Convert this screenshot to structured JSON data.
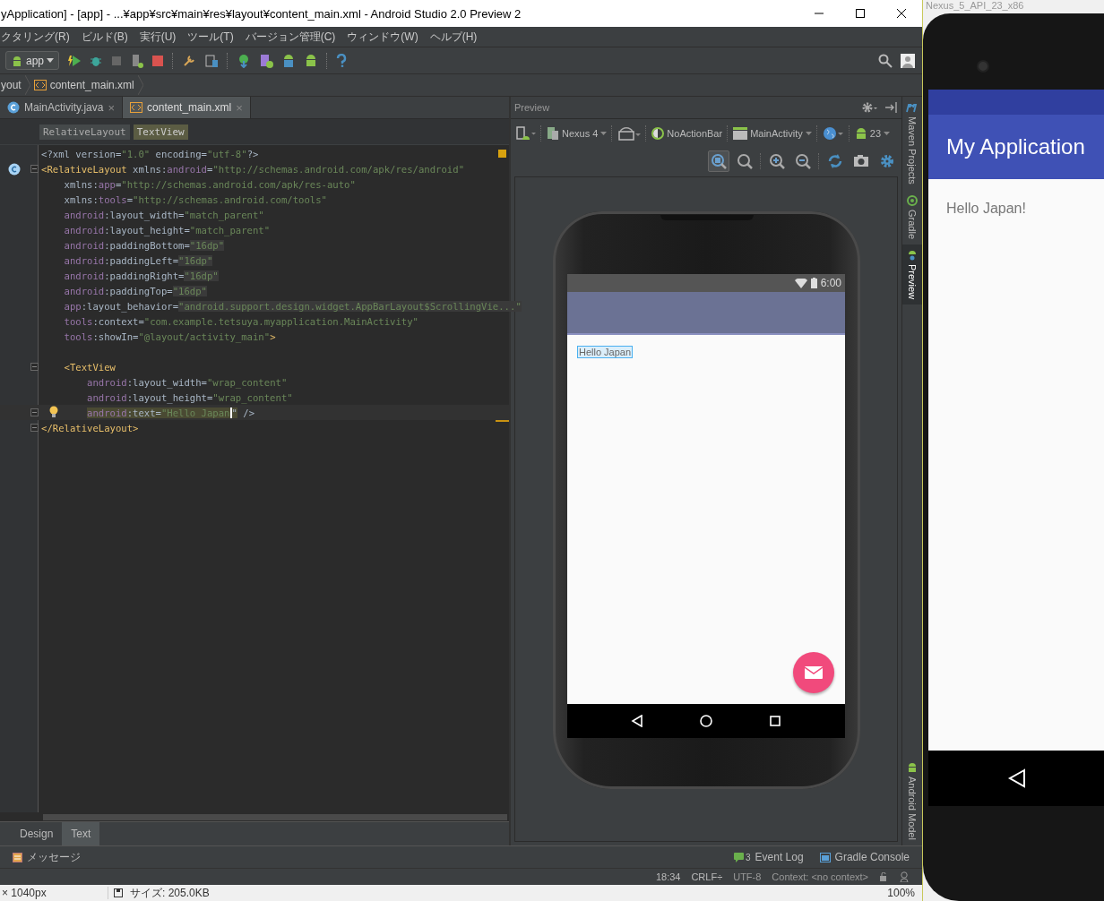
{
  "window": {
    "title": "yApplication] - [app] - ...¥app¥src¥main¥res¥layout¥content_main.xml - Android Studio 2.0 Preview 2"
  },
  "menu": [
    "クタリング(R)",
    "ビルド(B)",
    "実行(U)",
    "ツール(T)",
    "バージョン管理(C)",
    "ウィンドウ(W)",
    "ヘルプ(H)"
  ],
  "toolbar": {
    "run_config": "app"
  },
  "breadcrumb": [
    {
      "label": "yout",
      "kind": "folder"
    },
    {
      "label": "content_main.xml",
      "kind": "xml"
    }
  ],
  "editor_tabs": [
    {
      "label": "MainActivity.java",
      "kind": "java",
      "selected": false,
      "close": "×"
    },
    {
      "label": "content_main.xml",
      "kind": "xml",
      "selected": true,
      "close": "×"
    }
  ],
  "tag_path": [
    {
      "label": "RelativeLayout",
      "selected": false
    },
    {
      "label": "TextView",
      "selected": true
    }
  ],
  "code_lines": [
    {
      "current": false,
      "fold": false,
      "tokens": [
        {
          "kind": "p",
          "text": "<?xml version="
        },
        {
          "kind": "val",
          "text": "\"1.0\""
        },
        {
          "kind": "p",
          "text": " encoding="
        },
        {
          "kind": "val",
          "text": "\"utf-8\""
        },
        {
          "kind": "p",
          "text": "?>"
        }
      ]
    },
    {
      "kind": "class-marker",
      "current": false,
      "fold": true,
      "tokens": [
        {
          "kind": "tag",
          "text": "<RelativeLayout"
        },
        {
          "kind": "p",
          "text": " xmlns:"
        },
        {
          "kind": "ns",
          "text": "android"
        },
        {
          "kind": "p",
          "text": "="
        },
        {
          "kind": "val",
          "text": "\"http://schemas.android.com/apk/res/android\""
        }
      ],
      "children": [
        {
          "current": false,
          "fold": false,
          "tokens": [
            {
              "kind": "p",
              "text": "xmlns:"
            },
            {
              "kind": "ns",
              "text": "app"
            },
            {
              "kind": "p",
              "text": "="
            },
            {
              "kind": "val",
              "text": "\"http://schemas.android.com/apk/res-auto\""
            }
          ]
        },
        {
          "current": false,
          "fold": false,
          "tokens": [
            {
              "kind": "p",
              "text": "xmlns:"
            },
            {
              "kind": "ns",
              "text": "tools"
            },
            {
              "kind": "p",
              "text": "="
            },
            {
              "kind": "val",
              "text": "\"http://schemas.android.com/tools\""
            }
          ]
        },
        {
          "current": false,
          "fold": false,
          "tokens": [
            {
              "kind": "ns",
              "text": "android"
            },
            {
              "kind": "p",
              "text": ":layout_width="
            },
            {
              "kind": "val",
              "text": "\"match_parent\""
            }
          ]
        },
        {
          "current": false,
          "fold": false,
          "tokens": [
            {
              "kind": "ns",
              "text": "android"
            },
            {
              "kind": "p",
              "text": ":layout_height="
            },
            {
              "kind": "val",
              "text": "\"match_parent\""
            }
          ]
        },
        {
          "current": false,
          "fold": false,
          "tokens": [
            {
              "kind": "ns",
              "text": "android"
            },
            {
              "kind": "p",
              "text": ":paddingBottom="
            },
            {
              "kind": "fold",
              "text": "\"16dp\""
            }
          ]
        },
        {
          "current": false,
          "fold": false,
          "tokens": [
            {
              "kind": "ns",
              "text": "android"
            },
            {
              "kind": "p",
              "text": ":paddingLeft="
            },
            {
              "kind": "fold",
              "text": "\"16dp\""
            }
          ]
        },
        {
          "current": false,
          "fold": false,
          "tokens": [
            {
              "kind": "ns",
              "text": "android"
            },
            {
              "kind": "p",
              "text": ":paddingRight="
            },
            {
              "kind": "fold",
              "text": "\"16dp\""
            }
          ]
        },
        {
          "current": false,
          "fold": false,
          "tokens": [
            {
              "kind": "ns",
              "text": "android"
            },
            {
              "kind": "p",
              "text": ":paddingTop="
            },
            {
              "kind": "fold",
              "text": "\"16dp\""
            }
          ]
        },
        {
          "current": false,
          "fold": false,
          "tokens": [
            {
              "kind": "ns",
              "text": "app"
            },
            {
              "kind": "p",
              "text": ":layout_behavior="
            },
            {
              "kind": "fold",
              "text": "\"android.support.design.widget.AppBarLayout$ScrollingVie...\""
            }
          ]
        },
        {
          "current": false,
          "fold": false,
          "tokens": [
            {
              "kind": "ns",
              "text": "tools"
            },
            {
              "kind": "p",
              "text": ":context="
            },
            {
              "kind": "val",
              "text": "\"com.example.tetsuya.myapplication.MainActivity\""
            }
          ]
        },
        {
          "current": false,
          "fold": false,
          "tokens": [
            {
              "kind": "ns",
              "text": "tools"
            },
            {
              "kind": "p",
              "text": ":showIn="
            },
            {
              "kind": "val",
              "text": "\"@layout/activity_main\""
            },
            {
              "kind": "tag",
              "text": ">"
            }
          ]
        },
        {
          "current": false,
          "fold": false
        },
        {
          "current": false,
          "fold": true,
          "tokens": [
            {
              "kind": "tag",
              "text": "<TextView"
            }
          ],
          "children": [
            {
              "current": false,
              "fold": false,
              "tokens": [
                {
                  "kind": "ns",
                  "text": "android"
                },
                {
                  "kind": "p",
                  "text": ":layout_width="
                },
                {
                  "kind": "val",
                  "text": "\"wrap_content\""
                }
              ]
            },
            {
              "current": false,
              "fold": false,
              "tokens": [
                {
                  "kind": "ns",
                  "text": "android"
                },
                {
                  "kind": "p",
                  "text": ":layout_height="
                },
                {
                  "kind": "val",
                  "text": "\"wrap_content\""
                }
              ]
            },
            {
              "kind": "bulb-marker",
              "current": true,
              "fold": true,
              "tokens": [
                {
                  "kind": "selns",
                  "text": "android"
                },
                {
                  "kind": "sel",
                  "text": ":text="
                },
                {
                  "kind": "selcaret",
                  "text": "\"Hello Japan"
                },
                {
                  "kind": "sel",
                  "text": "\""
                },
                {
                  "kind": "p",
                  "text": " />"
                }
              ]
            }
          ]
        }
      ]
    },
    {
      "current": false,
      "fold": true,
      "tokens": [
        {
          "kind": "tag",
          "text": "</RelativeLayout>"
        }
      ]
    }
  ],
  "bottom_tabs": [
    {
      "label": "Design",
      "selected": false
    },
    {
      "label": "Text",
      "selected": true
    }
  ],
  "preview": {
    "title": "Preview",
    "device": "Nexus 4",
    "theme": "NoActionBar",
    "activity": "MainActivity",
    "api": "23",
    "phone": {
      "clock": "6:00",
      "text": "Hello Japan",
      "text_selected": true
    }
  },
  "side_tabs": [
    {
      "label": "Maven Projects",
      "kind": "maven",
      "selected": false
    },
    {
      "label": "Gradle",
      "kind": "gradle",
      "selected": false
    },
    {
      "label": "Preview",
      "kind": "preview",
      "selected": true
    },
    {
      "label": "Android Model",
      "kind": "android",
      "selected": false
    }
  ],
  "messages": "メッセージ",
  "tool_windows": [
    {
      "label": "Event Log",
      "badge": "3",
      "kind": "event"
    },
    {
      "label": "Gradle Console",
      "kind": "console"
    }
  ],
  "status": {
    "position": "18:34",
    "line_separator": "CRLF÷",
    "encoding": "UTF-8",
    "context": "Context: <no context>"
  },
  "taskbar": {
    "dimensions": "× 1040px",
    "size": "サイズ: 205.0KB",
    "zoom": "100%"
  },
  "emulator": {
    "title": "Nexus_5_API_23_x86",
    "app_title": "My Application",
    "text": "Hello Japan!"
  }
}
